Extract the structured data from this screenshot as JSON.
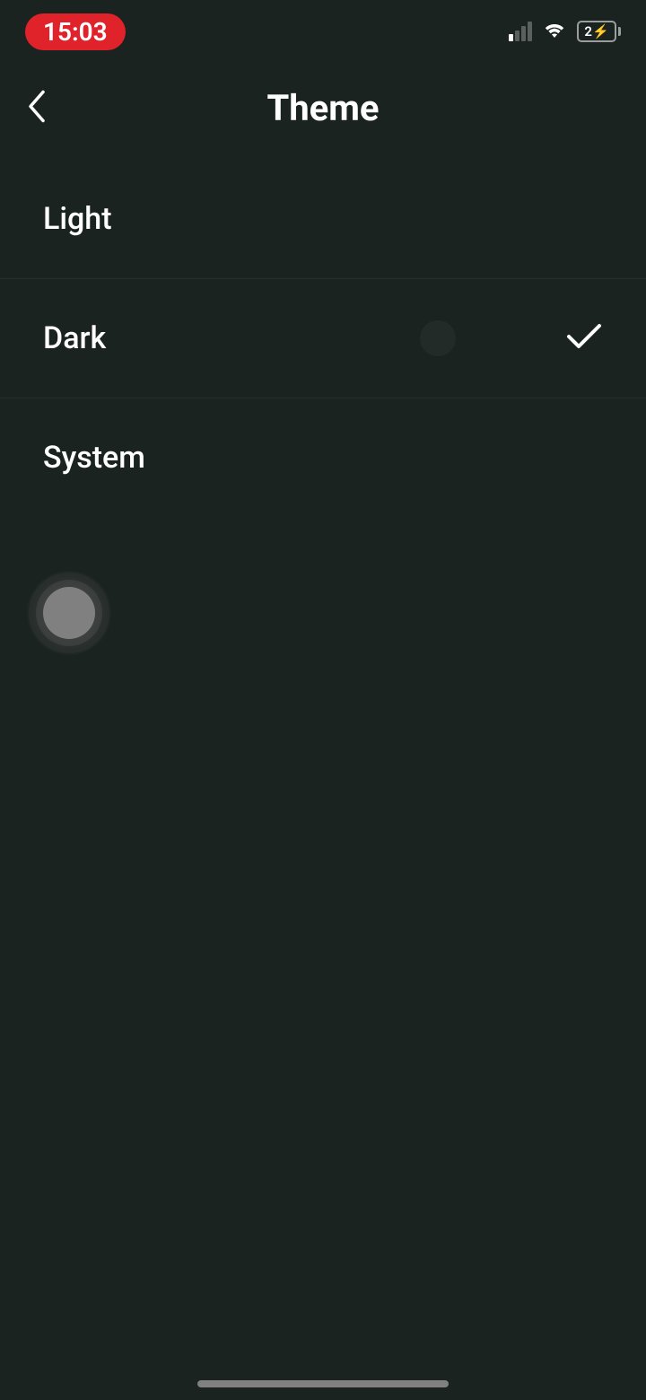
{
  "status_bar": {
    "time": "15:03",
    "battery_text": "2"
  },
  "header": {
    "title": "Theme"
  },
  "theme_options": [
    {
      "label": "Light",
      "selected": false
    },
    {
      "label": "Dark",
      "selected": true
    },
    {
      "label": "System",
      "selected": false
    }
  ]
}
